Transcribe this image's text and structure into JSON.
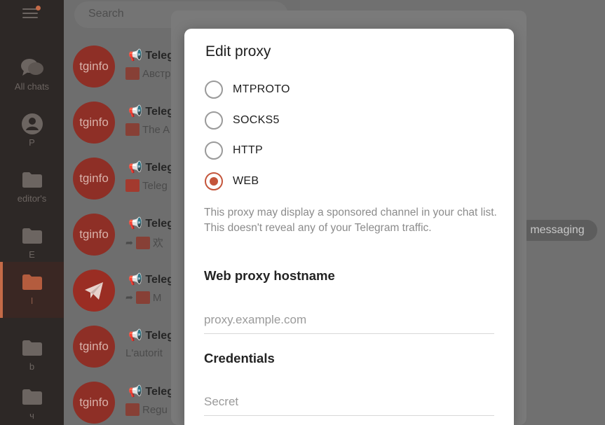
{
  "sidebar": {
    "menu_icon": "hamburger-icon",
    "accent_color": "#c46a47",
    "folders": [
      {
        "label": "All chats",
        "icon": "chats-icon",
        "active": false
      },
      {
        "label": "P",
        "icon": "person-icon",
        "active": false
      },
      {
        "label": "editor's",
        "icon": "folder-icon",
        "active": false
      },
      {
        "label": "E",
        "icon": "folder-icon",
        "active": false
      },
      {
        "label": "I",
        "icon": "folder-icon",
        "active": true
      },
      {
        "label": "b",
        "icon": "folder-icon",
        "active": false
      },
      {
        "label": "ч",
        "icon": "folder-icon",
        "active": false
      }
    ]
  },
  "search": {
    "placeholder": "Search"
  },
  "chats": [
    {
      "avatar": "tginfo",
      "title": "Teleg",
      "subtitle": "Австр",
      "sub_prefix": "image"
    },
    {
      "avatar": "tginfo",
      "title": "Teleg",
      "subtitle": "The A",
      "sub_prefix": "image"
    },
    {
      "avatar": "tginfo",
      "title": "Teleg",
      "subtitle": "Teleg",
      "sub_prefix": "image"
    },
    {
      "avatar": "tginfo",
      "title": "Teleg",
      "subtitle": "欢",
      "sub_prefix": "forward-image"
    },
    {
      "avatar": "telegram-logo",
      "title": "Teleg",
      "subtitle": "M",
      "sub_prefix": "forward-image"
    },
    {
      "avatar": "tginfo",
      "title": "Teleg",
      "subtitle": "L'autorit",
      "sub_prefix": "none"
    },
    {
      "avatar": "tginfo",
      "title": "Teleg",
      "subtitle": "Regu",
      "sub_prefix": "image"
    }
  ],
  "right_pane": {
    "pill_text": "messaging"
  },
  "dialog": {
    "title": "Edit proxy",
    "accent_color": "#c4553b",
    "proxy_types": [
      {
        "label": "MTPROTO",
        "checked": false
      },
      {
        "label": "SOCKS5",
        "checked": false
      },
      {
        "label": "HTTP",
        "checked": false
      },
      {
        "label": "WEB",
        "checked": true
      }
    ],
    "note": "This proxy may display a sponsored channel in your chat list. This doesn't reveal any of your Telegram traffic.",
    "hostname_heading": "Web proxy hostname",
    "hostname_placeholder": "proxy.example.com",
    "hostname_value": "",
    "credentials_heading": "Credentials",
    "secret_placeholder": "Secret",
    "secret_value": ""
  }
}
